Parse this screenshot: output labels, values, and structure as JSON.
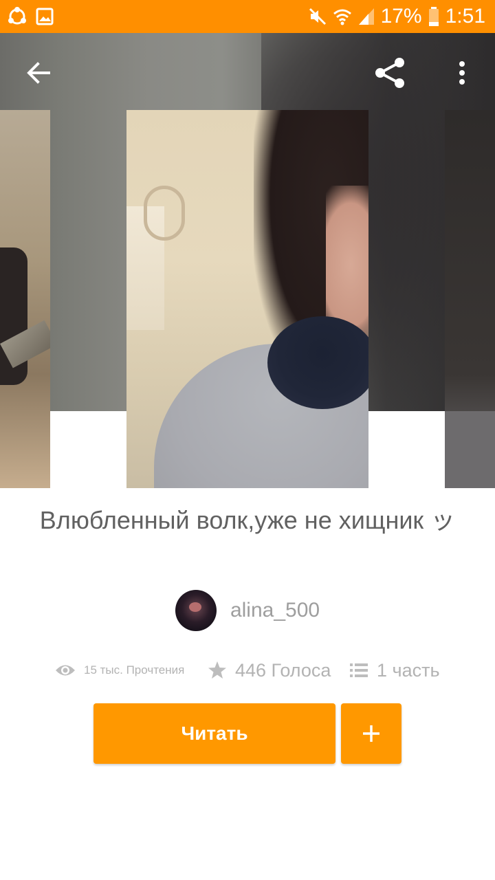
{
  "status_bar": {
    "battery_percent": "17%",
    "time": "1:51",
    "left_icons": [
      "sync-icon",
      "gallery-icon"
    ],
    "right_icons": [
      "mute-icon",
      "wifi-icon",
      "signal-icon",
      "battery-icon"
    ]
  },
  "toolbar": {
    "back_icon": "back-arrow-icon",
    "share_icon": "share-icon",
    "more_icon": "more-vertical-icon"
  },
  "story": {
    "title": "Влюбленный волк,уже не хищник ッ",
    "author": "alina_500",
    "reads_label": "15 тыс. Прочтения",
    "votes_label": "446 Голоса",
    "parts_label": "1 часть"
  },
  "actions": {
    "read_label": "Читать",
    "add_icon": "plus-icon"
  },
  "colors": {
    "accent": "#ff9800",
    "status_bar": "#ff8f00",
    "title_text": "#616161",
    "meta_text": "#b3b3b3"
  }
}
